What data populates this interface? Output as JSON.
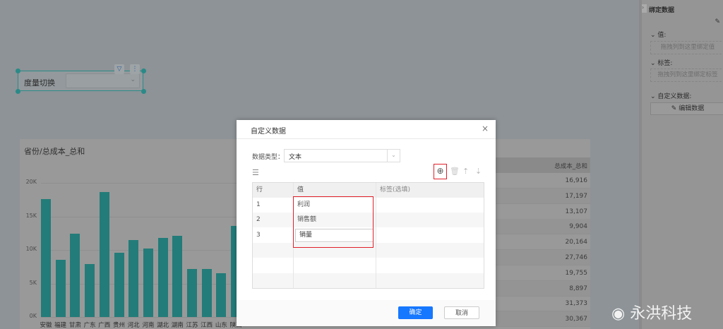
{
  "combo": {
    "label": "度量切换",
    "value": ""
  },
  "chart_data": {
    "type": "bar",
    "title": "省份/总成本_总和",
    "categories": [
      "安徽",
      "福建",
      "甘肃",
      "广东",
      "广西",
      "贵州",
      "河北",
      "河南",
      "湖北",
      "湖南",
      "江苏",
      "江西",
      "山东",
      "陕西"
    ],
    "values": [
      17600,
      8500,
      12400,
      7900,
      18600,
      9600,
      11500,
      10200,
      11800,
      12100,
      7200,
      7200,
      6500,
      13600
    ],
    "yticks": [
      "0K",
      "5K",
      "10K",
      "15K",
      "20K"
    ],
    "ylim": [
      0,
      20000
    ],
    "color": "#237c79"
  },
  "table": {
    "header": "总成本_总和",
    "values": [
      "16,916",
      "17,197",
      "13,107",
      "9,904",
      "20,164",
      "27,746",
      "19,755",
      "8,897",
      "31,373",
      "30,367"
    ]
  },
  "panel": {
    "title": "绑定数据",
    "value_label": "值:",
    "value_drop": "拖拽列到这里绑定值",
    "label_label": "标签:",
    "label_drop": "拖拽列到这里绑定标签",
    "custom_label": "自定义数据:",
    "edit_button": "编辑数据"
  },
  "dialog": {
    "title": "自定义数据",
    "type_label": "数据类型：",
    "type_value": "文本",
    "columns": [
      "行",
      "值",
      "标签(选填)"
    ],
    "rows": [
      {
        "n": "1",
        "v": "利润"
      },
      {
        "n": "2",
        "v": "销售额"
      },
      {
        "n": "3",
        "v": "销量"
      }
    ],
    "ok": "确定",
    "cancel": "取消"
  },
  "watermark": "永洪科技"
}
